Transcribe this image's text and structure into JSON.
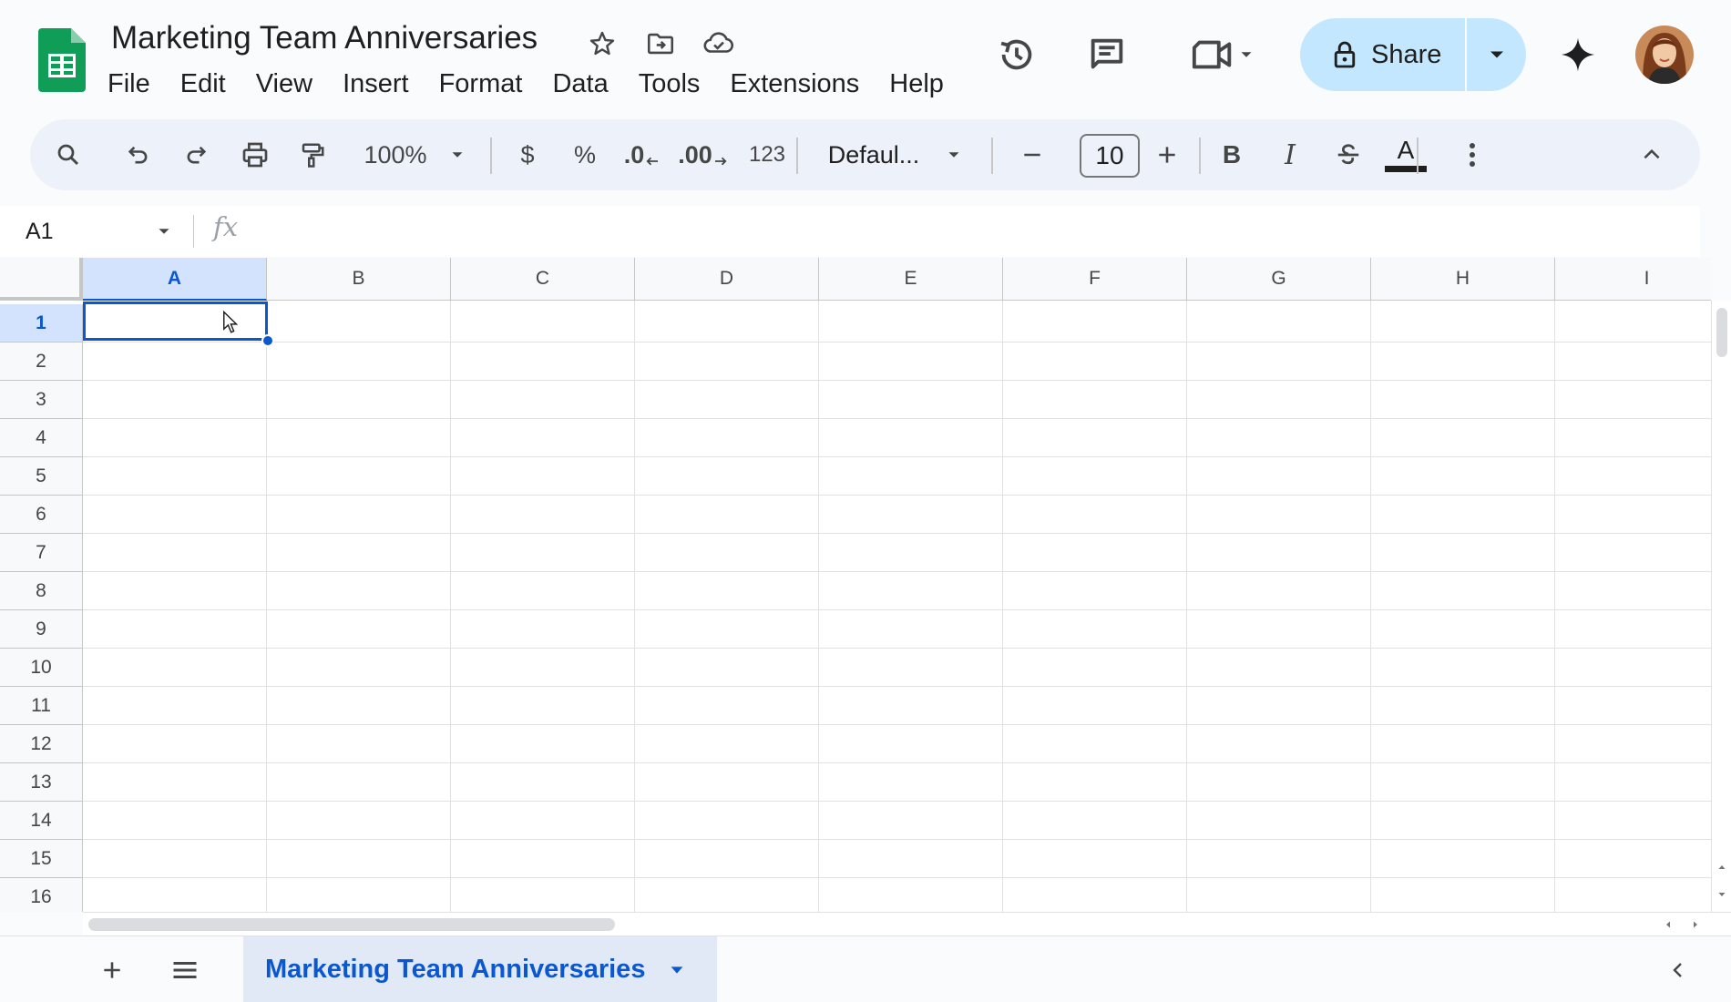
{
  "app": {
    "title": "Marketing Team Anniversaries",
    "colors": {
      "brand_green": "#0f9d58",
      "accent_blue": "#0b57d0",
      "share_bg": "#c2e7ff",
      "selection_header": "#d3e3fd"
    }
  },
  "header": {
    "title_icons": [
      "star-icon",
      "move-to-folder-icon",
      "cloud-saved-icon"
    ],
    "menu": [
      "File",
      "Edit",
      "View",
      "Insert",
      "Format",
      "Data",
      "Tools",
      "Extensions",
      "Help"
    ],
    "right_icons": [
      "version-history-icon",
      "comments-icon",
      "meet-camera-icon",
      "gemini-sparkle-icon"
    ],
    "share_label": "Share"
  },
  "toolbar": {
    "zoom": "100%",
    "currency": "$",
    "percent": "%",
    "decrease_decimal": ".0",
    "increase_decimal": ".00",
    "number_format": "123",
    "font": "Defaul...",
    "font_size": "10",
    "bold": "B",
    "italic": "I",
    "text_color": "A"
  },
  "formula_bar": {
    "name_box": "A1",
    "fx": "fx",
    "value": ""
  },
  "grid": {
    "columns": [
      "A",
      "B",
      "C",
      "D",
      "E",
      "F",
      "G",
      "H",
      "I"
    ],
    "rows": [
      "1",
      "2",
      "3",
      "4",
      "5",
      "6",
      "7",
      "8",
      "9",
      "10",
      "11",
      "12",
      "13",
      "14",
      "15",
      "16"
    ],
    "selected_cell": "A1"
  },
  "sheets": {
    "tabs": [
      {
        "label": "Marketing Team Anniversaries",
        "active": true
      }
    ]
  }
}
